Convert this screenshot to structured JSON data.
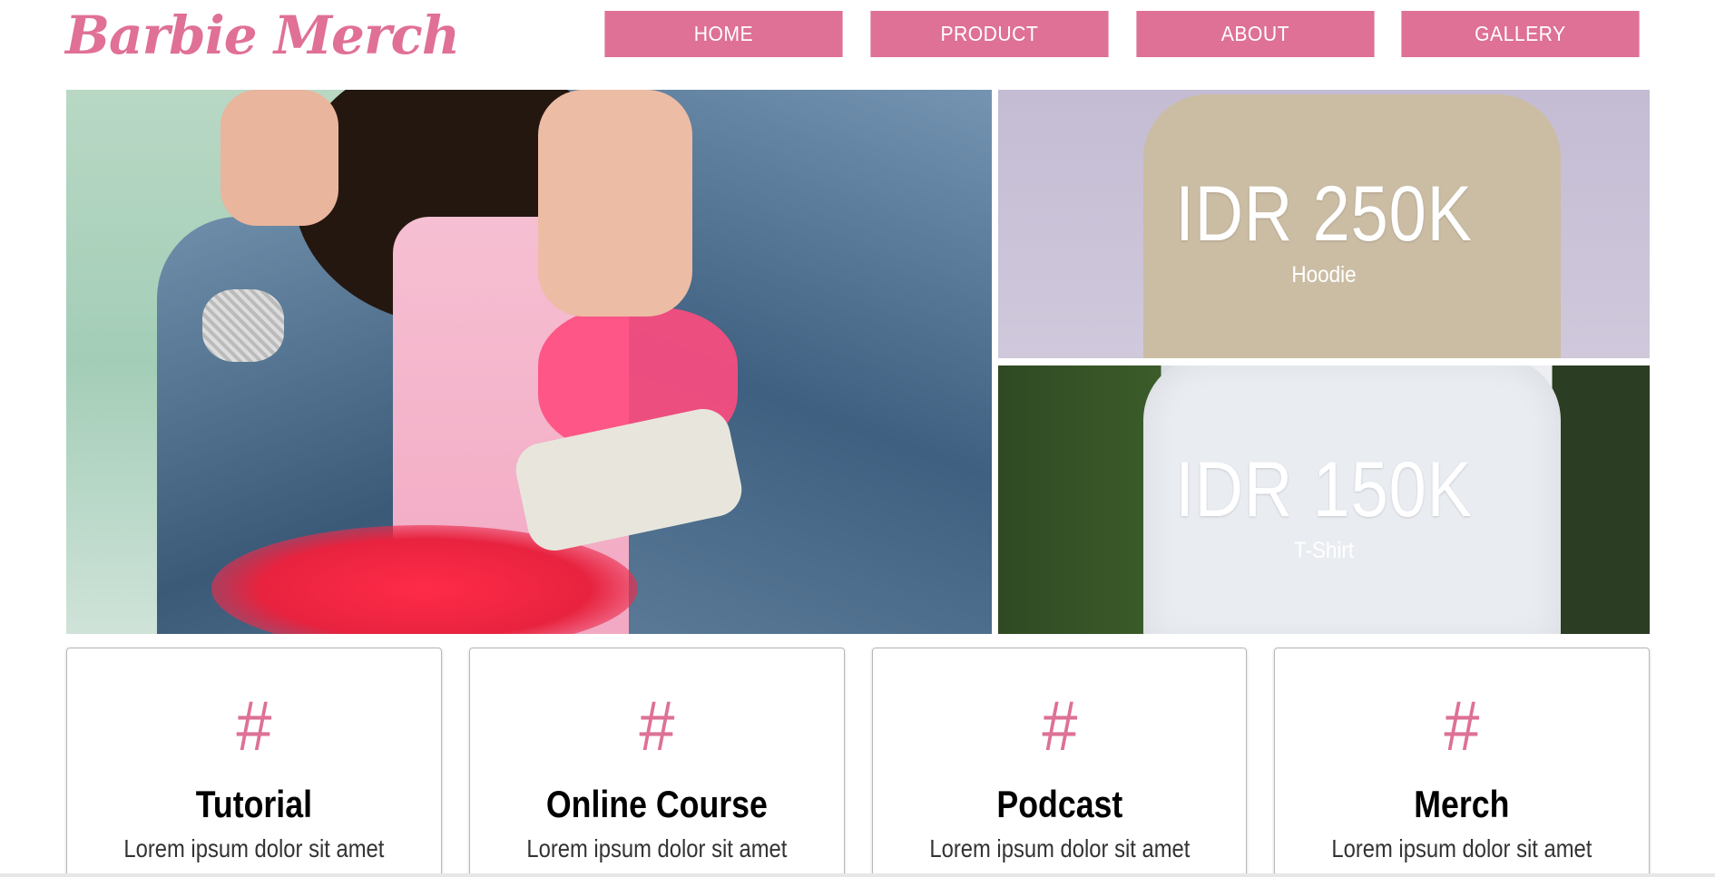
{
  "brand": {
    "logo_text": "Barbie Merch",
    "accent_color": "#de7195"
  },
  "nav": {
    "items": [
      {
        "label": "HOME"
      },
      {
        "label": "PRODUCT"
      },
      {
        "label": "ABOUT"
      },
      {
        "label": "GALLERY"
      }
    ]
  },
  "products": [
    {
      "price": "IDR 250K",
      "name": "Hoodie"
    },
    {
      "price": "IDR 150K",
      "name": "T-Shirt"
    }
  ],
  "features": [
    {
      "icon": "#",
      "title": "Tutorial",
      "desc": "Lorem ipsum dolor sit amet"
    },
    {
      "icon": "#",
      "title": "Online Course",
      "desc": "Lorem ipsum dolor sit amet"
    },
    {
      "icon": "#",
      "title": "Podcast",
      "desc": "Lorem ipsum dolor sit amet"
    },
    {
      "icon": "#",
      "title": "Merch",
      "desc": "Lorem ipsum dolor sit amet"
    }
  ]
}
